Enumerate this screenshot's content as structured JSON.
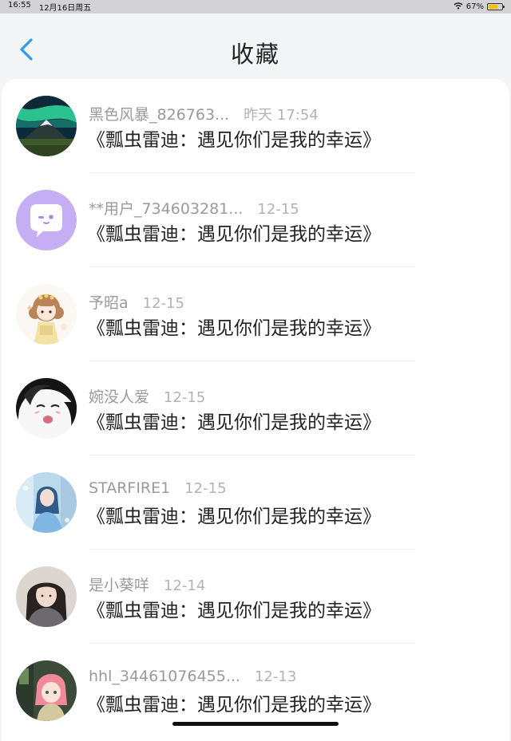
{
  "status_bar": {
    "time": "16:55",
    "date": "12月16日周五",
    "battery": "67%",
    "battery_level": 0.67
  },
  "header": {
    "title": "收藏"
  },
  "items": [
    {
      "username": "黑色风暴_826763...",
      "time": "昨天 17:54",
      "title": "《瓢虫雷迪：遇见你们是我的幸运》",
      "avatar": "aurora-mountain-avatar"
    },
    {
      "username": "**用户_734603281...",
      "time": "12-15",
      "title": "《瓢虫雷迪：遇见你们是我的幸运》",
      "avatar": "chat-bubble-avatar"
    },
    {
      "username": "予昭a",
      "time": "12-15",
      "title": "《瓢虫雷迪：遇见你们是我的幸运》",
      "avatar": "cartoon-girl-avatar"
    },
    {
      "username": "婉没人爱",
      "time": "12-15",
      "title": "《瓢虫雷迪：遇见你们是我的幸运》",
      "avatar": "anime-face-avatar"
    },
    {
      "username": "STARFIRE1",
      "time": "12-15",
      "title": "《瓢虫雷迪：遇见你们是我的幸运》",
      "avatar": "blue-portrait-avatar"
    },
    {
      "username": "是小葵咩",
      "time": "12-14",
      "title": "《瓢虫雷迪：遇见你们是我的幸运》",
      "avatar": "photo-portrait-avatar"
    },
    {
      "username": "hhl_34461076455...",
      "time": "12-13",
      "title": "《瓢虫雷迪：遇见你们是我的幸运》",
      "avatar": "pink-hair-avatar"
    }
  ],
  "colors": {
    "accent": "#2f9bf0",
    "background": "#f4f5f7"
  }
}
